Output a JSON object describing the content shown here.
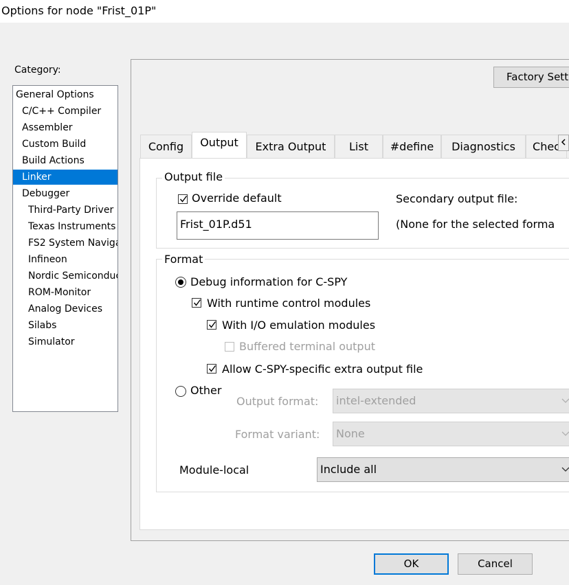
{
  "window": {
    "title": "Options for node \"Frist_01P\""
  },
  "category": {
    "label": "Category:",
    "items": [
      {
        "label": "General Options",
        "level": 0
      },
      {
        "label": "C/C++ Compiler",
        "level": 1
      },
      {
        "label": "Assembler",
        "level": 1
      },
      {
        "label": "Custom Build",
        "level": 1
      },
      {
        "label": "Build Actions",
        "level": 1
      },
      {
        "label": "Linker",
        "level": 1,
        "selected": true
      },
      {
        "label": "Debugger",
        "level": 1
      },
      {
        "label": "Third-Party Driver",
        "level": 2
      },
      {
        "label": "Texas Instruments",
        "level": 2
      },
      {
        "label": "FS2 System Naviga",
        "level": 2
      },
      {
        "label": "Infineon",
        "level": 2
      },
      {
        "label": "Nordic Semiconduc",
        "level": 2
      },
      {
        "label": "ROM-Monitor",
        "level": 2
      },
      {
        "label": "Analog Devices",
        "level": 2
      },
      {
        "label": "Silabs",
        "level": 2
      },
      {
        "label": "Simulator",
        "level": 2
      }
    ]
  },
  "factory_settings_label": "Factory Setti",
  "tabs": [
    {
      "label": "Config"
    },
    {
      "label": "Output",
      "active": true
    },
    {
      "label": "Extra Output"
    },
    {
      "label": "List"
    },
    {
      "label": "#define"
    },
    {
      "label": "Diagnostics"
    },
    {
      "label": "Chec"
    }
  ],
  "output_file": {
    "legend": "Output file",
    "override_label": "Override default",
    "override_checked": true,
    "filename": "Frist_01P.d51",
    "secondary_label": "Secondary output file:",
    "secondary_value": "(None for the selected forma"
  },
  "format": {
    "legend": "Format",
    "debug_label": "Debug information for C-SPY",
    "runtime_label": "With runtime control modules",
    "io_label": "With I/O emulation modules",
    "buffered_label": "Buffered terminal output",
    "allow_label": "Allow C-SPY-specific extra output file",
    "other_label": "Other",
    "output_format_label": "Output format:",
    "output_format_value": "intel-extended",
    "format_variant_label": "Format variant:",
    "format_variant_value": "None",
    "module_local_label": "Module-local",
    "module_local_value": "Include all"
  },
  "buttons": {
    "ok": "OK",
    "cancel": "Cancel"
  },
  "colors": {
    "selection": "#0078d7",
    "ok_border": "#0078d7"
  }
}
